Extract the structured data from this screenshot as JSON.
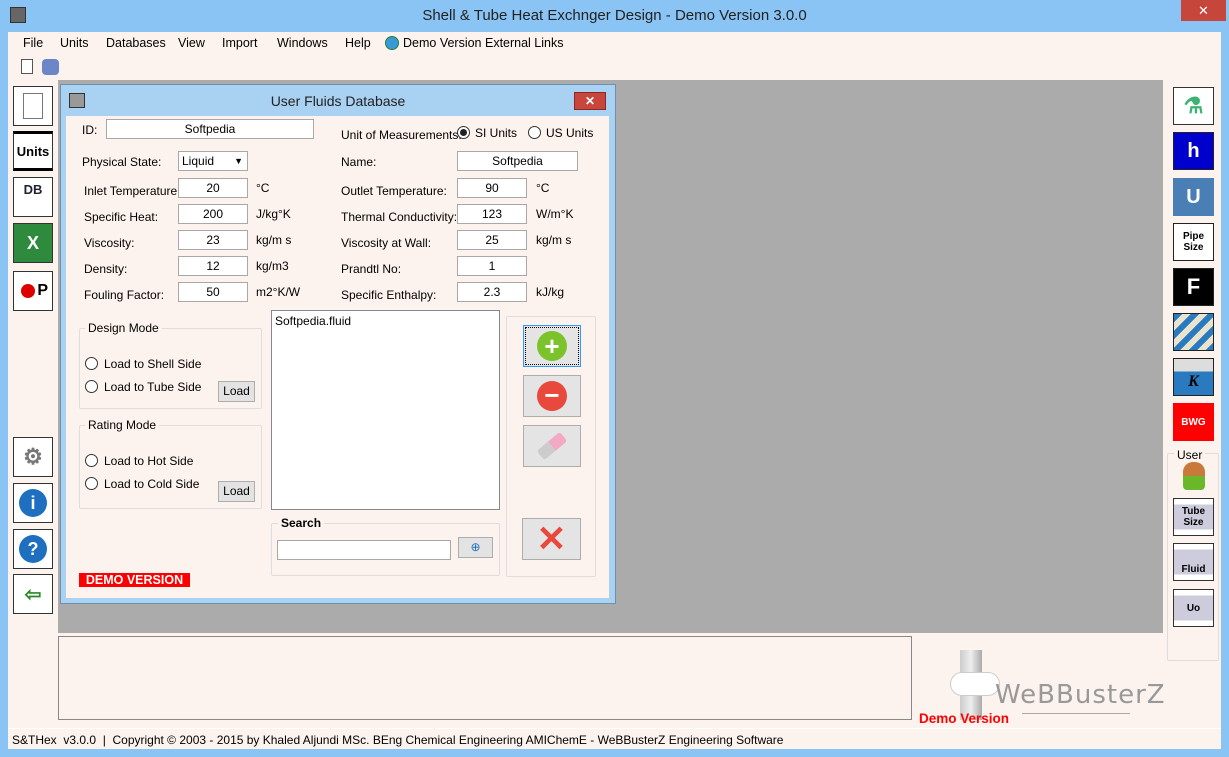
{
  "window": {
    "title": "Shell & Tube Heat Exchnger Design - Demo Version 3.0.0",
    "close": "✕"
  },
  "menu": [
    "File",
    "Units",
    "Databases",
    "View",
    "Import",
    "Windows",
    "Help",
    "Demo Version External Links"
  ],
  "left_toolbar": [
    "new-file",
    "Units",
    "DB",
    "excel",
    "pressure-P",
    "settings",
    "info",
    "help",
    "exit"
  ],
  "left_labels": {
    "units": "Units",
    "db": "DB",
    "p": "P"
  },
  "dialog": {
    "title": "User Fluids Database",
    "close": "✕",
    "id_label": "ID:",
    "id_value": "Softpedia",
    "unit_label": "Unit of Measurements:",
    "si": "SI Units",
    "us": "US Units",
    "selected_unit": "SI Units",
    "state_label": "Physical State:",
    "state_value": "Liquid",
    "name_label": "Name:",
    "name_value": "Softpedia",
    "left_fields": [
      {
        "label": "Inlet Temperature:",
        "value": "20",
        "unit": "°C"
      },
      {
        "label": "Specific Heat:",
        "value": "200",
        "unit": "J/kg°K"
      },
      {
        "label": "Viscosity:",
        "value": "23",
        "unit": "kg/m s"
      },
      {
        "label": "Density:",
        "value": "12",
        "unit": "kg/m3"
      },
      {
        "label": "Fouling Factor:",
        "value": "50",
        "unit": "m2°K/W"
      }
    ],
    "right_fields": [
      {
        "label": "Outlet Temperature:",
        "value": "90",
        "unit": "°C"
      },
      {
        "label": "Thermal Conductivity:",
        "value": "123",
        "unit": "W/m°K"
      },
      {
        "label": "Viscosity at Wall:",
        "value": "25",
        "unit": "kg/m s"
      },
      {
        "label": "Prandtl No:",
        "value": "1",
        "unit": ""
      },
      {
        "label": "Specific Enthalpy:",
        "value": "2.3",
        "unit": "kJ/kg"
      }
    ],
    "design_mode": {
      "title": "Design Mode",
      "opt1": "Load to Shell Side",
      "opt2": "Load to Tube Side",
      "load": "Load"
    },
    "rating_mode": {
      "title": "Rating Mode",
      "opt1": "Load to Hot Side",
      "opt2": "Load to Cold Side",
      "load": "Load"
    },
    "files": [
      "Softpedia.fluid"
    ],
    "search": {
      "title": "Search",
      "value": ""
    },
    "demo": "DEMO VERSION"
  },
  "right_toolbar": {
    "items": [
      "flask",
      "h",
      "U",
      "Pipe Size",
      "F",
      "tube-layout",
      "K",
      "BWG"
    ],
    "h": "h",
    "u": "U",
    "pipe": "Pipe Size",
    "f": "F",
    "k": "K",
    "bwg": "BWG",
    "user_title": "User",
    "tube": "Tube Size",
    "fluid": "Fluid",
    "uo": "Uo"
  },
  "logo": {
    "text": "WeBBusterZ",
    "demo": "Demo Version"
  },
  "status": "S&THex  v3.0.0  |  Copyright © 2003 - 2015 by Khaled Aljundi MSc. BEng Chemical Engineering AMIChemE - WeBBusterZ Engineering Software",
  "colors": {
    "title_bar": "#8ac4f4",
    "background": "#fdf3ee",
    "mdi": "#ababab",
    "h_btn": "#0000cc",
    "u_btn": "#4a7fb5",
    "bwg": "#ff0000",
    "demo": "#ff0000"
  }
}
